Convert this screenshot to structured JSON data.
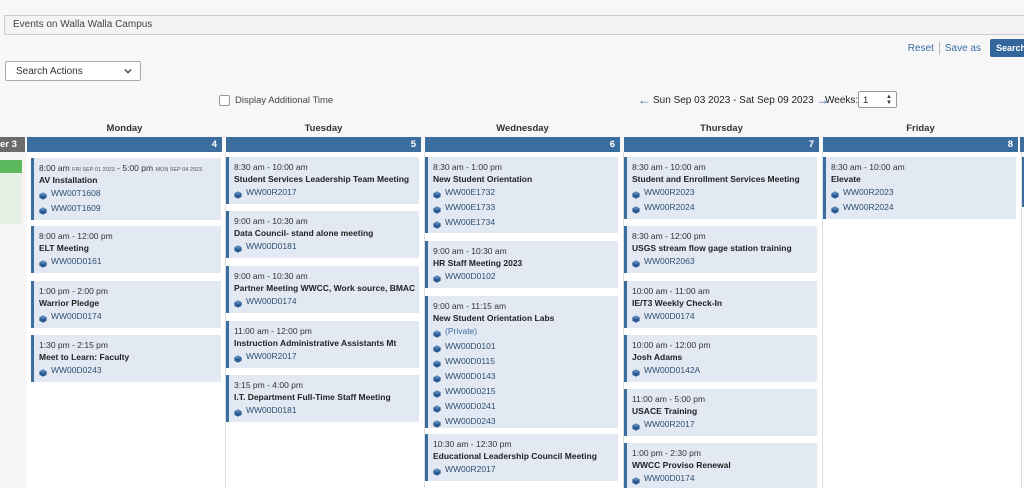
{
  "header": {
    "title": "Events on Walla Walla Campus",
    "reset_label": "Reset",
    "saveas_label": "Save as",
    "search_label": "Search"
  },
  "toolbar": {
    "actions_label": "Search Actions",
    "additional_time_label": "Display Additional Time",
    "date_range": "Sun Sep 03 2023 - Sat Sep 09 2023",
    "weeks_label": "Weeks:",
    "weeks_value": "1"
  },
  "calendar": {
    "prev_day_label": "er 3",
    "days": [
      {
        "name": "Monday",
        "num": "4",
        "events": [
          {
            "time": "8:00 am",
            "time_sm": "FRI SEP 01 2023",
            "time2": " - 5:00 pm",
            "time2_sm": "MON SEP 04 2023",
            "title": "AV Installation",
            "locations": [
              "WW00T1608",
              "WW00T1609"
            ]
          },
          {
            "time": "8:00 am - 12:00 pm",
            "title": "ELT Meeting",
            "locations": [
              "WW00D0161"
            ]
          },
          {
            "time": "1:00 pm - 2:00 pm",
            "title": "Warrior Pledge",
            "locations": [
              "WW00D0174"
            ]
          },
          {
            "time": "1:30 pm - 2:15 pm",
            "title": "Meet to Learn: Faculty",
            "locations": [
              "WW00D0243"
            ]
          }
        ]
      },
      {
        "name": "Tuesday",
        "num": "5",
        "events": [
          {
            "time": "8:30 am - 10:00 am",
            "title": "Student Services Leadership Team Meeting",
            "locations": [
              "WW00R2017"
            ]
          },
          {
            "time": "9:00 am - 10:30 am",
            "title": "Data Council- stand alone meeting",
            "locations": [
              "WW00D0181"
            ]
          },
          {
            "time": "9:00 am - 10:30 am",
            "title": "Partner Meeting WWCC, Work source, BMAC",
            "locations": [
              "WW00D0174"
            ]
          },
          {
            "time": "11:00 am - 12:00 pm",
            "title": "Instruction Administrative Assistants Mt",
            "locations": [
              "WW00R2017"
            ]
          },
          {
            "time": "3:15 pm - 4:00 pm",
            "title": "I.T. Department Full-Time Staff Meeting",
            "locations": [
              "WW00D0181"
            ]
          }
        ]
      },
      {
        "name": "Wednesday",
        "num": "6",
        "events": [
          {
            "time": "8:30 am - 1:00 pm",
            "title": "New Student Orientation",
            "locations": [
              "WW00E1732",
              "WW00E1733",
              "WW00E1734"
            ]
          },
          {
            "time": "9:00 am - 10:30 am",
            "title": "HR Staff Meeting 2023",
            "locations": [
              "WW00D0102"
            ]
          },
          {
            "time": "9:00 am - 11:15 am",
            "title": "New Student Orientation Labs",
            "locations": [
              "(Private)",
              "WW00D0101",
              "WW00D0115",
              "WW00D0143",
              "WW00D0215",
              "WW00D0241",
              "WW00D0243"
            ]
          },
          {
            "time": "10:30 am - 12:30 pm",
            "title": "Educational Leadership Council Meeting",
            "locations": [
              "WW00R2017"
            ]
          }
        ]
      },
      {
        "name": "Thursday",
        "num": "7",
        "events": [
          {
            "time": "8:30 am - 10:00 am",
            "title": "Student and Enrollment Services Meeting",
            "locations": [
              "WW00R2023",
              "WW00R2024"
            ]
          },
          {
            "time": "8:30 am - 12:00 pm",
            "title": "USGS stream flow gage station training",
            "locations": [
              "WW00R2063"
            ]
          },
          {
            "time": "10:00 am - 11:00 am",
            "title": "IE/T3 Weekly Check-In",
            "locations": [
              "WW00D0174"
            ]
          },
          {
            "time": "10:00 am - 12:00 pm",
            "title": "Josh Adams",
            "locations": [
              "WW00D0142A"
            ]
          },
          {
            "time": "11:00 am - 5:00 pm",
            "title": "USACE Training",
            "locations": [
              "WW00R2017"
            ]
          },
          {
            "time": "1:00 pm - 2:30 pm",
            "title": "WWCC Proviso Renewal",
            "locations": [
              "WW00D0174"
            ]
          }
        ]
      },
      {
        "name": "Friday",
        "num": "8",
        "events": [
          {
            "time": "8:30 am - 10:00 am",
            "title": "Elevate",
            "locations": [
              "WW00R2023",
              "WW00R2024"
            ]
          }
        ]
      }
    ]
  },
  "colors": {
    "accent": "#3c6d9f",
    "event_bg": "#e2e9f3",
    "link": "#3a6ea5"
  }
}
